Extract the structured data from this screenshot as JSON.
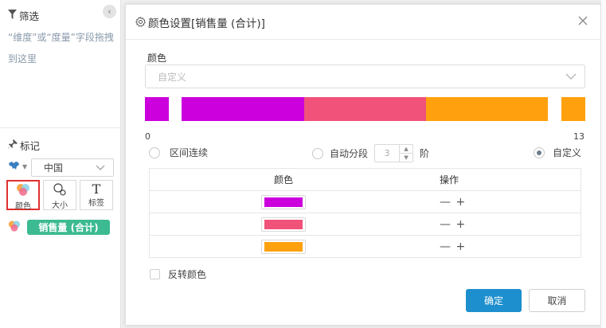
{
  "sidebar": {
    "filter_title": "筛选",
    "filter_hint": "“维度”或“度量”字段拖拽到这里",
    "marks_title": "标记",
    "map_select_value": "中国",
    "buttons": [
      {
        "label": "颜色",
        "icon": "color-icon"
      },
      {
        "label": "大小",
        "icon": "size-icon"
      },
      {
        "label": "标签",
        "icon": "label-text-icon"
      }
    ],
    "measure_label": "销售量 (合计)"
  },
  "dialog": {
    "title": "颜色设置[销售量 (合计)]",
    "color_label": "颜色",
    "preset_placeholder": "自定义",
    "range_min": "0",
    "range_max": "13",
    "mode_continuous": "区间连续",
    "mode_auto_segments": "自动分段",
    "segments_value": "3",
    "segments_unit": "阶",
    "mode_custom": "自定义",
    "table_header_color": "颜色",
    "table_header_ops": "操作",
    "ops_symbols": "— +",
    "reverse_label": "反转颜色",
    "ok_label": "确定",
    "cancel_label": "取消"
  },
  "colors": {
    "magenta": "#cc00dd",
    "pink": "#f0527a",
    "orange": "#ffa10f",
    "accent": "#1e8fce",
    "measure_pill": "#3cba92"
  }
}
